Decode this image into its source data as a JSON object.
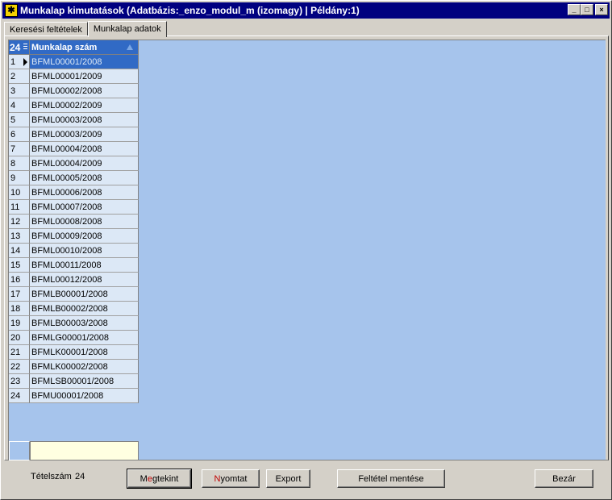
{
  "window": {
    "title": "Munkalap kimutatások  (Adatbázis:_enzo_modul_m (izomagy) | Példány:1)",
    "app_icon": "app-icon",
    "controls": {
      "minimize": "_",
      "maximize": "□",
      "close": "×"
    }
  },
  "tabs": [
    {
      "label": "Keresési feltételek",
      "active": false
    },
    {
      "label": "Munkalap adatok",
      "active": true
    }
  ],
  "grid": {
    "row_count_header": "24",
    "column_header": "Munkalap szám",
    "selected_row": 1,
    "rows": [
      {
        "idx": "1",
        "value": "BFML00001/2008"
      },
      {
        "idx": "2",
        "value": "BFML00001/2009"
      },
      {
        "idx": "3",
        "value": "BFML00002/2008"
      },
      {
        "idx": "4",
        "value": "BFML00002/2009"
      },
      {
        "idx": "5",
        "value": "BFML00003/2008"
      },
      {
        "idx": "6",
        "value": "BFML00003/2009"
      },
      {
        "idx": "7",
        "value": "BFML00004/2008"
      },
      {
        "idx": "8",
        "value": "BFML00004/2009"
      },
      {
        "idx": "9",
        "value": "BFML00005/2008"
      },
      {
        "idx": "10",
        "value": "BFML00006/2008"
      },
      {
        "idx": "11",
        "value": "BFML00007/2008"
      },
      {
        "idx": "12",
        "value": "BFML00008/2008"
      },
      {
        "idx": "13",
        "value": "BFML00009/2008"
      },
      {
        "idx": "14",
        "value": "BFML00010/2008"
      },
      {
        "idx": "15",
        "value": "BFML00011/2008"
      },
      {
        "idx": "16",
        "value": "BFML00012/2008"
      },
      {
        "idx": "17",
        "value": "BFMLB00001/2008"
      },
      {
        "idx": "18",
        "value": "BFMLB00002/2008"
      },
      {
        "idx": "19",
        "value": "BFMLB00003/2008"
      },
      {
        "idx": "20",
        "value": "BFMLG00001/2008"
      },
      {
        "idx": "21",
        "value": "BFMLK00001/2008"
      },
      {
        "idx": "22",
        "value": "BFMLK00002/2008"
      },
      {
        "idx": "23",
        "value": "BFMLSB00001/2008"
      },
      {
        "idx": "24",
        "value": "BFMU00001/2008"
      }
    ],
    "filter_value": ""
  },
  "footer": {
    "count_label": "Tételszám",
    "count_value": "24",
    "buttons": {
      "view": {
        "pre": "M",
        "accel": "e",
        "post": "gtekint"
      },
      "print": {
        "pre": "",
        "accel": "N",
        "post": "yomtat"
      },
      "export": "Export",
      "save_filter": "Feltétel mentése",
      "close": "Bezár"
    }
  },
  "colors": {
    "title_bar": "#000080",
    "grid_background": "#a6c4ec",
    "row_background": "#dce8f6",
    "selected_row": "#316ac5",
    "filter_background": "#ffffe1",
    "accelerator": "#c00000"
  }
}
